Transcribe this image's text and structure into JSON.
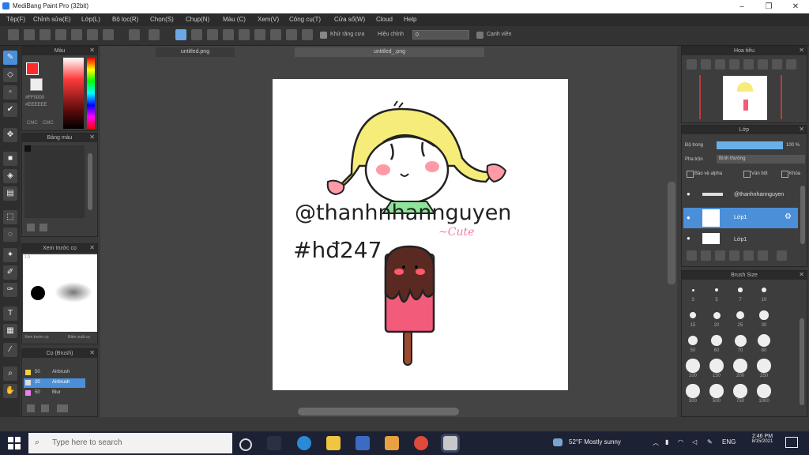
{
  "window": {
    "title": "MediBang Paint Pro (32bit)",
    "controls": [
      "–",
      "❐",
      "✕"
    ]
  },
  "menu": [
    "Tệp(F)",
    "Chỉnh sửa(E)",
    "Lớp(L)",
    "Bộ lọc(R)",
    "Chọn(S)",
    "Chụp(N)",
    "Màu (C)",
    "Xem(V)",
    "Công cụ(T)",
    "Cửa sổ(W)",
    "Cloud",
    "Help"
  ],
  "toolbar": {
    "anti_alias_label": "Khử răng cưa",
    "correction_label": "Hiệu chỉnh",
    "correction_value": "0",
    "edge_label": "Cạnh viền"
  },
  "doc_tabs": [
    "untitled.png",
    "untitled_.png"
  ],
  "color_panel": {
    "title": "Màu",
    "hex_line1": "#FF0000",
    "hex_line2": "#EEEEEE",
    "ctrl_a": "CMC",
    "ctrl_b": "CMC"
  },
  "palette_panel": {
    "title": "Bảng màu"
  },
  "brush_preview": {
    "title": "Xem trước cọ",
    "size": "1.0",
    "footer_left": "Xem trước cọ",
    "footer_right": "Bấm xuất cọ"
  },
  "brush_list": {
    "title": "Cọ (Brush)",
    "items": [
      {
        "size": "50",
        "name": "Airbrush"
      },
      {
        "size": "20",
        "name": "Airbrush",
        "selected": true
      },
      {
        "size": "50",
        "name": "Blur"
      }
    ]
  },
  "canvas": {
    "handle": "@thanhnhannguyen",
    "tag": "#hđ247",
    "scribble": "~Cute"
  },
  "navigator": {
    "title": "Hoa tiêu"
  },
  "layer_panel": {
    "title": "Lớp",
    "opacity_label": "Độ trong",
    "opacity_value": "100 %",
    "opacity_fraction": 1.0,
    "blend_label": "Pha trộn",
    "blend_value": "Bình thường",
    "options": [
      "Bảo vệ alpha",
      "Ván bột",
      "Khóa"
    ],
    "layers": [
      {
        "name": "@thanhnhannguyen",
        "kind": "text"
      },
      {
        "name": "Lớp1",
        "kind": "image",
        "selected": true
      },
      {
        "name": "Lớp1",
        "kind": "image"
      }
    ]
  },
  "brush_size_panel": {
    "title": "Brush Size",
    "sizes": [
      "3",
      "5",
      "7",
      "10",
      "15",
      "20",
      "25",
      "30",
      "50",
      "60",
      "70",
      "80",
      "100",
      "150",
      "200",
      "250",
      "300",
      "500",
      "750",
      "1000"
    ]
  },
  "taskbar": {
    "search_placeholder": "Type here to search",
    "weather": "52°F  Mostly sunny",
    "lang": "ENG",
    "time": "2:46 PM",
    "date": "8/15/2021"
  }
}
